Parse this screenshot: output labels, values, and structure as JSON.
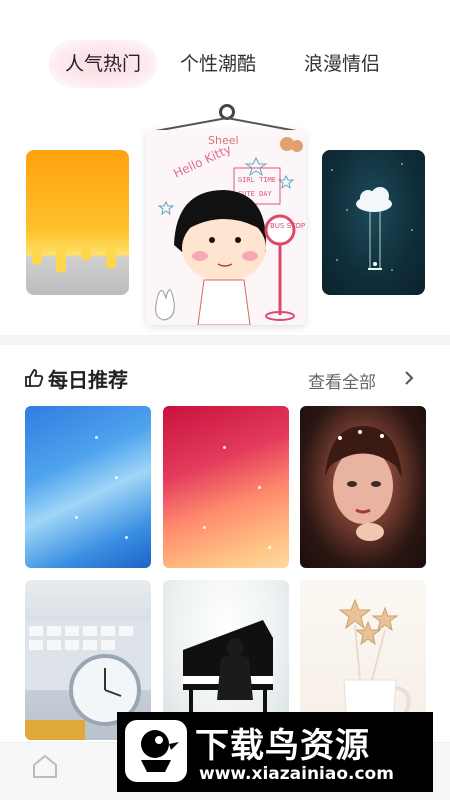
{
  "tabs": [
    {
      "label": "人气热门",
      "active": true
    },
    {
      "label": "个性潮酷",
      "active": false
    },
    {
      "label": "浪漫情侣",
      "active": false
    }
  ],
  "carousel": {
    "items": [
      {
        "name": "orange-drip-wallpaper"
      },
      {
        "name": "chibi-maruko-wallpaper",
        "sign_text": "BUS STOP"
      },
      {
        "name": "cloud-swing-wallpaper"
      }
    ]
  },
  "daily": {
    "title": "每日推荐",
    "view_all": "查看全部",
    "icons": {
      "title_icon": "thumbs-up-icon",
      "view_all_icon": "chevron-right-icon"
    },
    "tiles": [
      {
        "name": "blue-light-wallpaper"
      },
      {
        "name": "red-light-wallpaper"
      },
      {
        "name": "girl-portrait-wallpaper"
      },
      {
        "name": "keyboard-clock-wallpaper"
      },
      {
        "name": "piano-wallpaper"
      },
      {
        "name": "star-cookies-wallpaper"
      }
    ]
  },
  "bottom_nav": {
    "home_icon": "home-icon"
  },
  "watermark": {
    "title": "下载鸟资源",
    "url": "www.xiazainiao.com"
  },
  "colors": {
    "active_tab_bg": "#fde4ea",
    "divider": "#f4f4f4",
    "watermark_bg": "#000000"
  }
}
